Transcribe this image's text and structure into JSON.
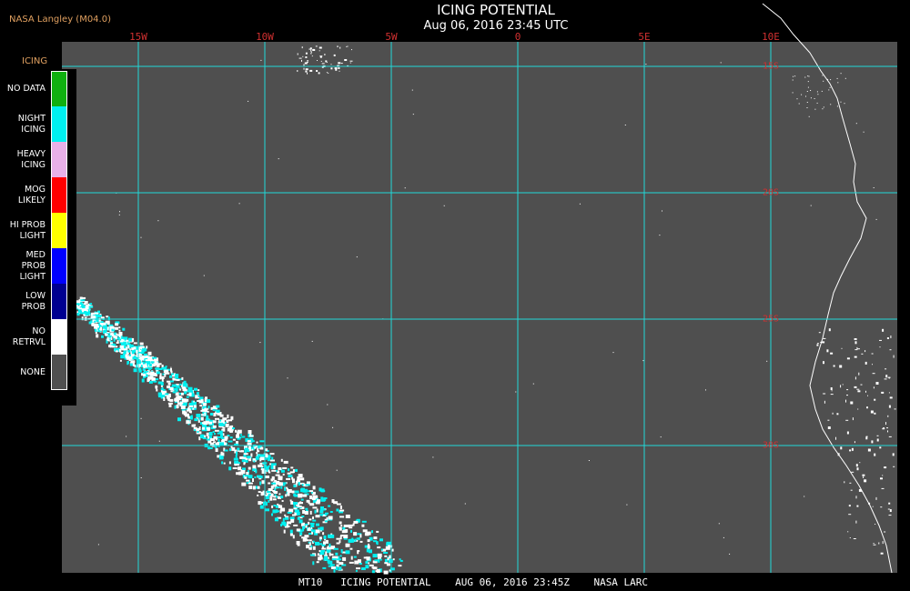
{
  "header": {
    "title": "ICING POTENTIAL",
    "subtitle": "Aug 06, 2016 23:45 UTC",
    "producer": "NASA Langley (M04.0)"
  },
  "map": {
    "background_color": "#4f4f4f",
    "grid_color": "#20d8d8",
    "coast_color": "#ffffff",
    "longitudes": [
      {
        "label": "15W",
        "value": -15
      },
      {
        "label": "10W",
        "value": -10
      },
      {
        "label": "5W",
        "value": -5
      },
      {
        "label": "0",
        "value": 0
      },
      {
        "label": "5E",
        "value": 5
      },
      {
        "label": "10E",
        "value": 10
      }
    ],
    "latitudes": [
      {
        "label": "15S",
        "value": -15
      },
      {
        "label": "20S",
        "value": -20
      },
      {
        "label": "25S",
        "value": -25
      },
      {
        "label": "30S",
        "value": -30
      }
    ]
  },
  "legend": {
    "title": "ICING",
    "items": [
      {
        "label": "NO DATA",
        "color": "#10b010"
      },
      {
        "label": "NIGHT\nICING",
        "color": "#00f0f0"
      },
      {
        "label": "HEAVY\nICING",
        "color": "#e8b0e8"
      },
      {
        "label": "MOG\nLIKELY",
        "color": "#ff0000"
      },
      {
        "label": "HI PROB\nLIGHT",
        "color": "#ffff00"
      },
      {
        "label": "MED PROB\nLIGHT",
        "color": "#0000ff"
      },
      {
        "label": "LOW\nPROB",
        "color": "#000090"
      },
      {
        "label": "NO\nRETRVL",
        "color": "#ffffff"
      },
      {
        "label": "NONE",
        "color": "#505050"
      }
    ]
  },
  "footer": {
    "text": "MT10   ICING POTENTIAL    AUG 06, 2016 23:45Z    NASA LARC"
  }
}
